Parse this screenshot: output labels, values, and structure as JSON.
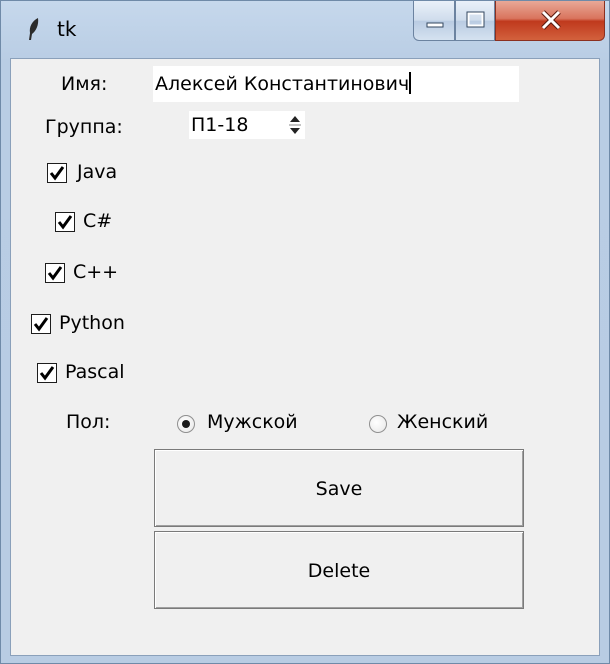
{
  "window": {
    "title": "tk",
    "colors": {
      "close_button": "#c0391d",
      "titlebar": "#c6d8ec",
      "client_bg": "#f0f0f0"
    }
  },
  "form": {
    "name_label": "Имя:",
    "name_value": "Алексей Константинович",
    "group_label": "Группа:",
    "group_value": "П1-18",
    "languages": [
      {
        "label": "Java",
        "checked": true
      },
      {
        "label": "C#",
        "checked": true
      },
      {
        "label": "C++",
        "checked": true
      },
      {
        "label": "Python",
        "checked": true
      },
      {
        "label": "Pascal",
        "checked": true
      }
    ],
    "gender_label": "Пол:",
    "gender_options": [
      {
        "label": "Мужской",
        "selected": true
      },
      {
        "label": "Женский",
        "selected": false
      }
    ],
    "save_label": "Save",
    "delete_label": "Delete"
  },
  "icons": {
    "app": "feather-icon",
    "minimize": "minimize-icon",
    "maximize": "maximize-icon",
    "close": "close-icon",
    "spin": "spin-arrows-icon",
    "check": "checkmark-icon"
  }
}
